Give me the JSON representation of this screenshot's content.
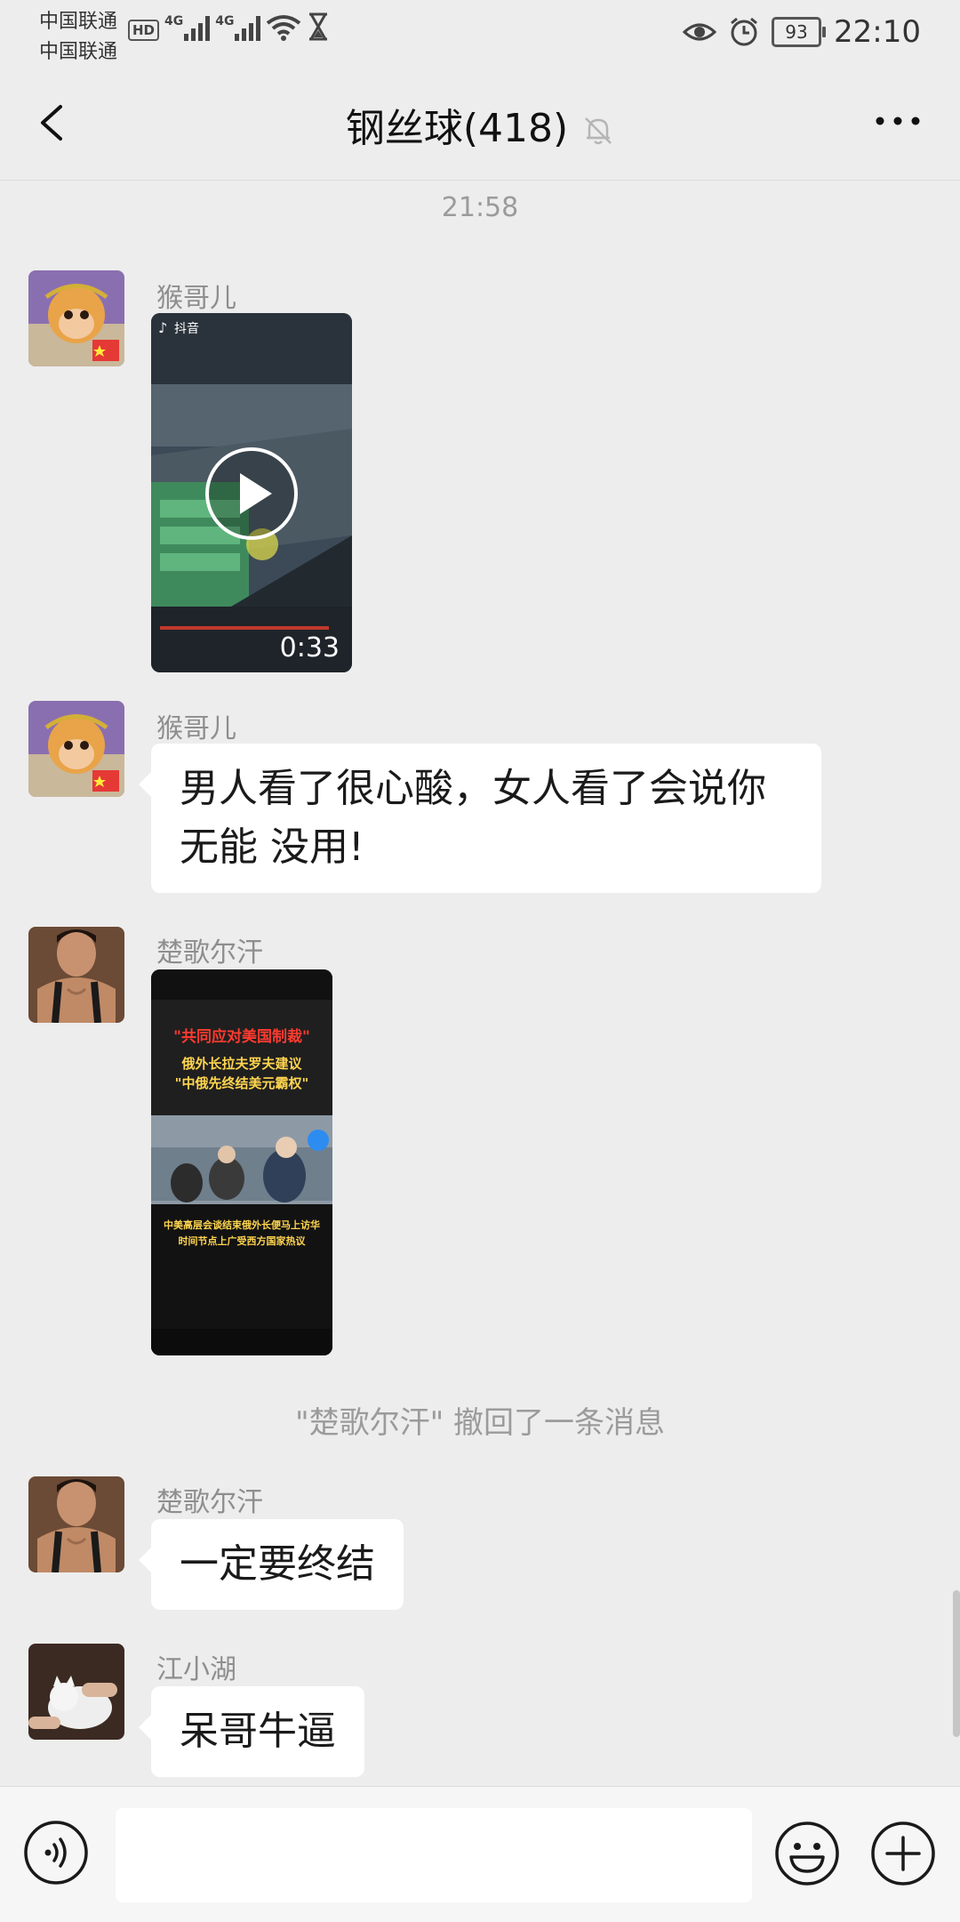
{
  "status_bar": {
    "carrier_1": "中国联通",
    "carrier_2": "中国联通",
    "hd": "HD",
    "network_1": "4G",
    "network_2": "4G",
    "battery": "93",
    "time": "22:10"
  },
  "header": {
    "title": "钢丝球(418)"
  },
  "chat": {
    "timestamp": "21:58",
    "messages": [
      {
        "sender": "猴哥儿",
        "type": "video",
        "duration": "0:33",
        "watermark": "抖音"
      },
      {
        "sender": "猴哥儿",
        "type": "text",
        "line1": "男人看了很心酸，女人看了会说你",
        "line2": "无能 没用!"
      },
      {
        "sender": "楚歌尔汗",
        "type": "video",
        "headline_1": "\"共同应对美国制裁\"",
        "headline_2": "俄外长拉夫罗夫建议",
        "headline_3": "\"中俄先终结美元霸权\"",
        "caption_1": "中美高层会谈结束俄外长便马上访华",
        "caption_2": "时间节点上广受西方国家热议"
      },
      {
        "sender": "楚歌尔汗",
        "type": "text",
        "text": "一定要终结"
      },
      {
        "sender": "江小湖",
        "type": "text",
        "text": "呆哥牛逼"
      }
    ],
    "recall_notice": "\"楚歌尔汗\" 撤回了一条消息"
  },
  "input": {
    "placeholder": ""
  }
}
